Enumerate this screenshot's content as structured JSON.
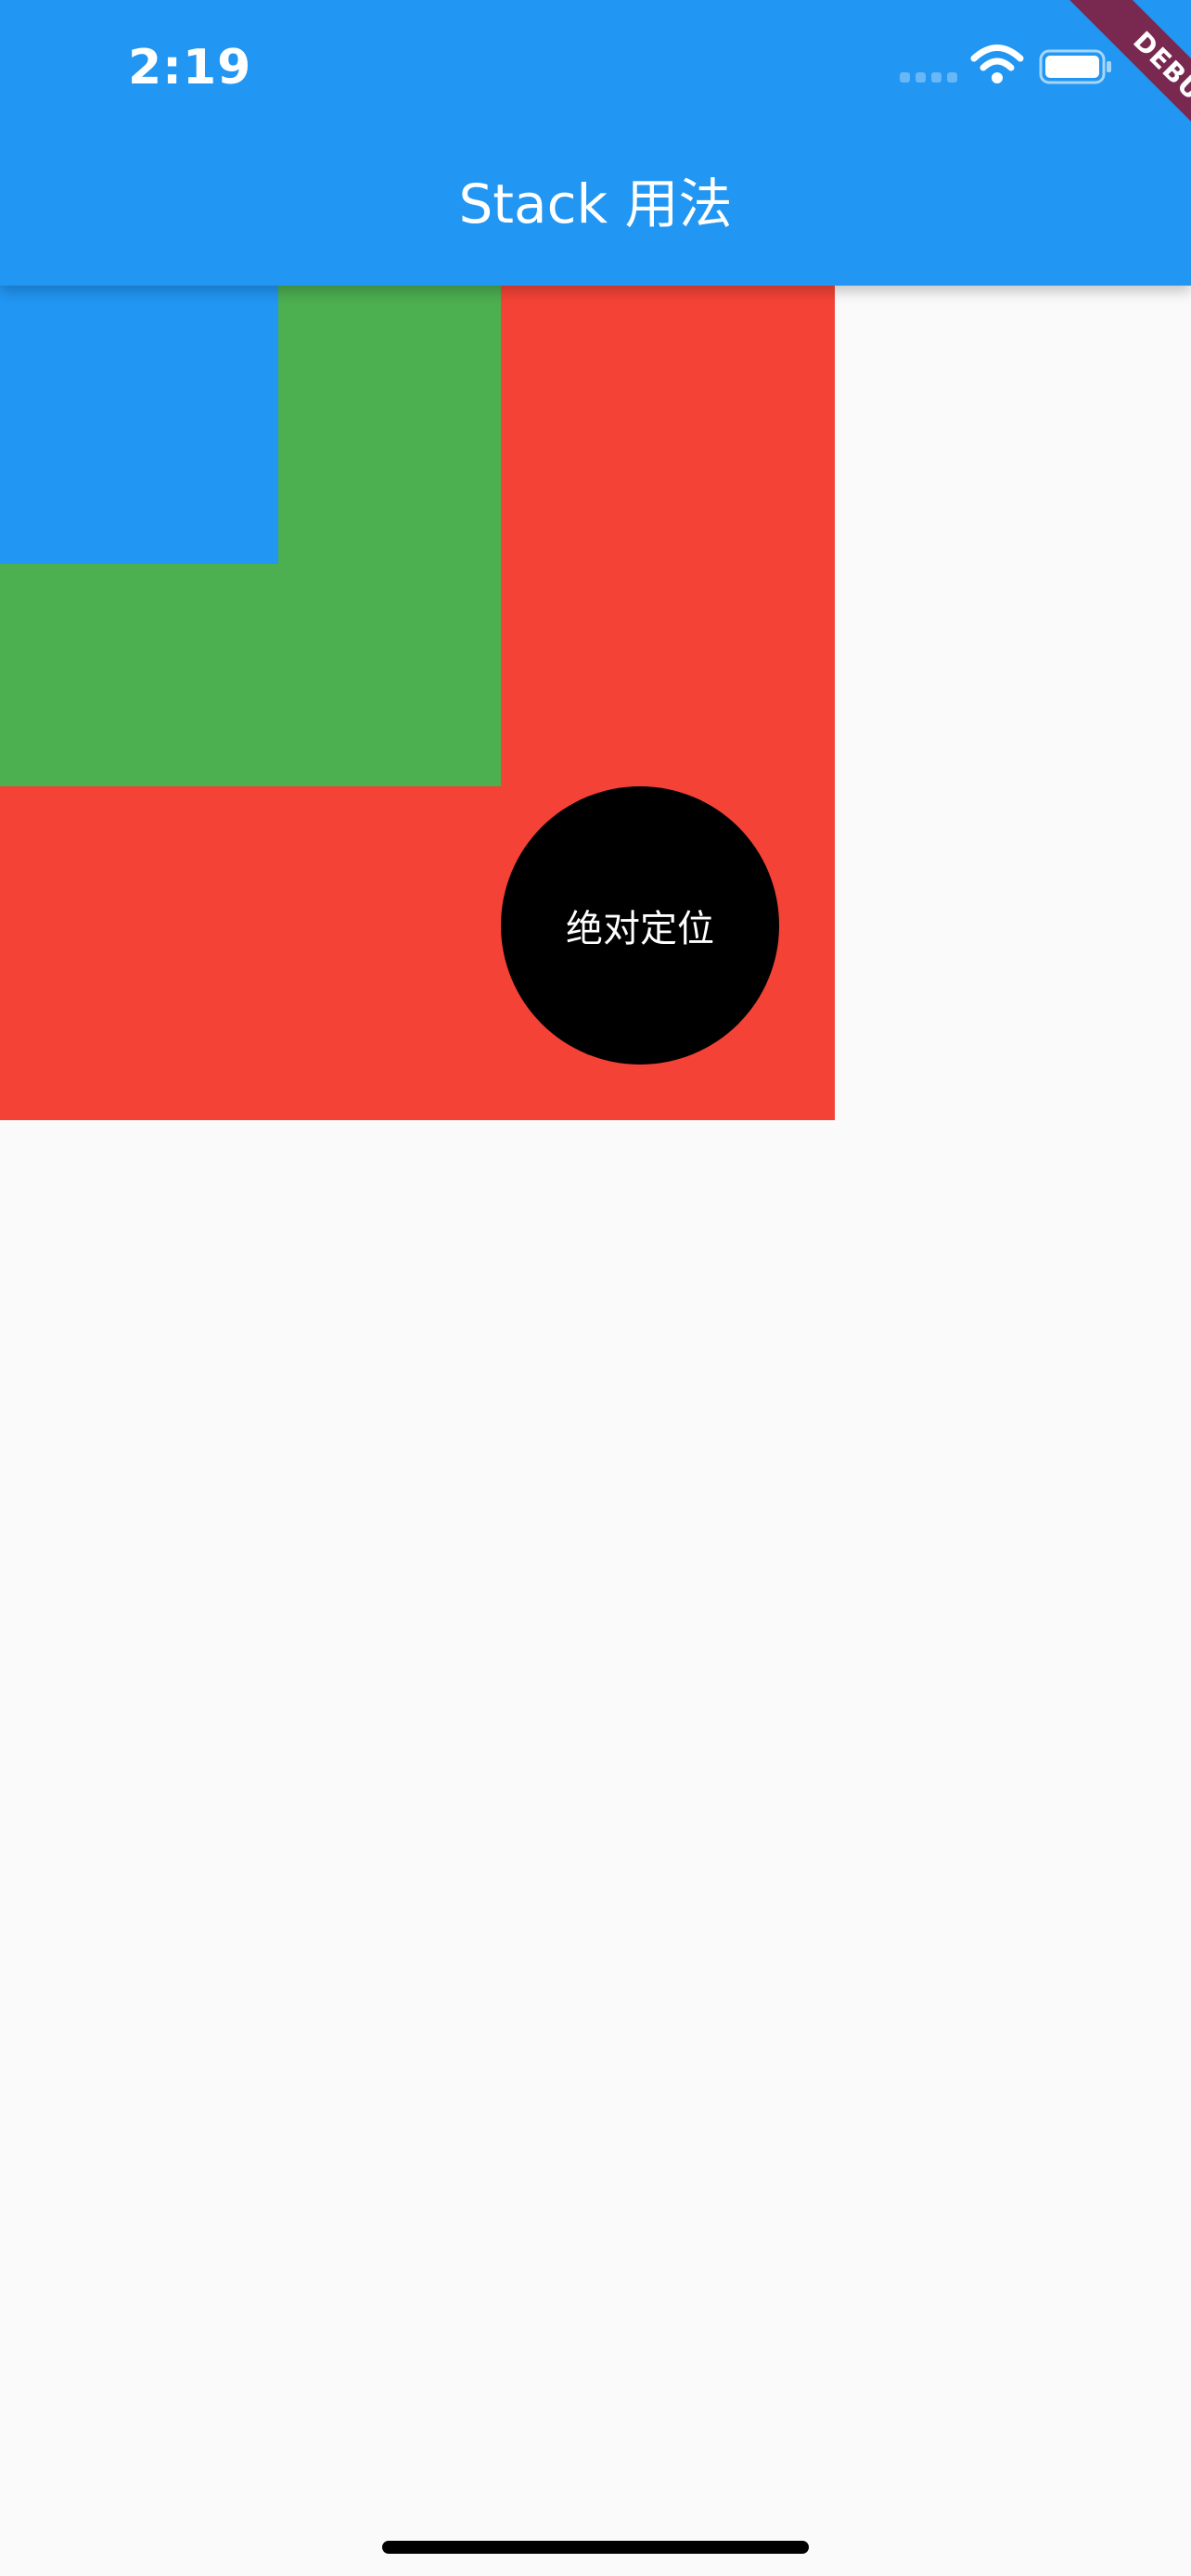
{
  "status_bar": {
    "time": "2:19"
  },
  "app_bar": {
    "title": "Stack 用法"
  },
  "stack": {
    "circle_label": "绝对定位",
    "colors": {
      "red": "#f44336",
      "green": "#4caf50",
      "blue": "#2196f3",
      "circle": "#000000"
    }
  },
  "debug_banner": {
    "label": "DEBUG"
  },
  "colors": {
    "app_bar": "#2196f3",
    "background": "#fafafa"
  }
}
